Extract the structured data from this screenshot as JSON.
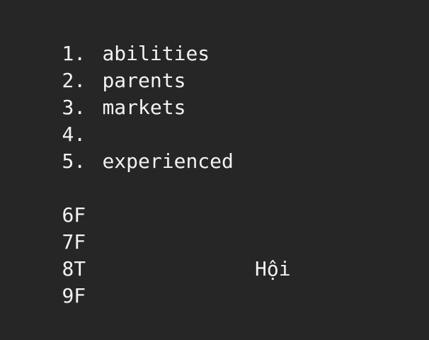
{
  "style": {
    "background": "#262626",
    "text_color": "#f2f2f2"
  },
  "list": [
    {
      "number": "1.",
      "word": "abilities"
    },
    {
      "number": "2.",
      "word": "parents"
    },
    {
      "number": "3.",
      "word": "markets"
    },
    {
      "number": "4.",
      "word": ""
    },
    {
      "number": "5.",
      "word": "experienced"
    }
  ],
  "answers": [
    "6F",
    "7F",
    "8T",
    "9F"
  ],
  "extra_word": "Hội"
}
